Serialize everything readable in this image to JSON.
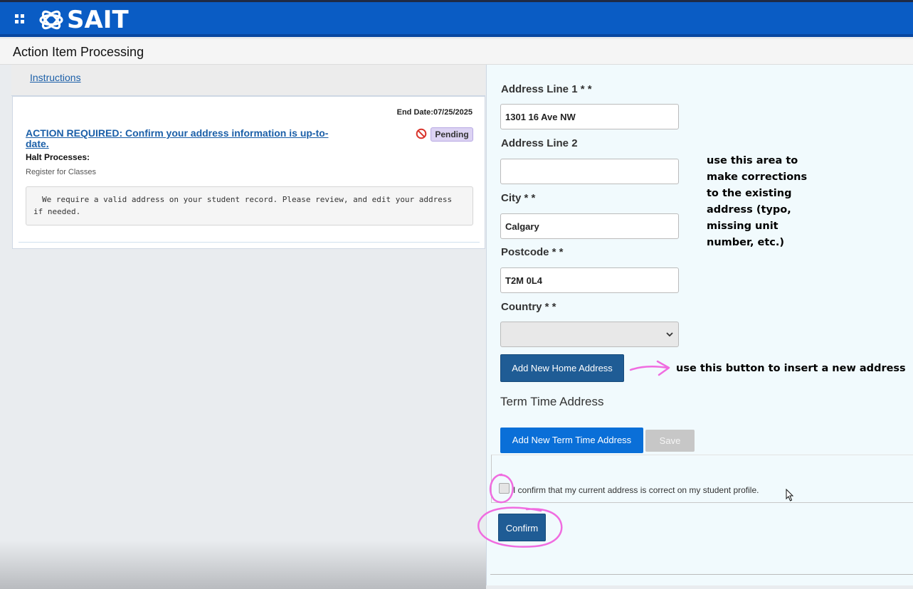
{
  "header": {
    "app_menu_icon": "grid-icon",
    "logo_text": "SAIT",
    "page_title": "Action Item Processing"
  },
  "left": {
    "instructions_link": "Instructions",
    "end_date": "End Date:07/25/2025",
    "action_title": "ACTION REQUIRED: Confirm your address information is up-to-date.",
    "status_icon": "no-entry-icon",
    "status_badge": "Pending",
    "halt_label": "Halt Processes:",
    "halt_value": "Register for Classes",
    "message": "We require a valid address on your student record. Please review, and edit your address if needed."
  },
  "form": {
    "address1_label": "Address Line 1 * *",
    "address1_value": "1301 16 Ave NW",
    "address2_label": "Address Line 2",
    "address2_value": "",
    "city_label": "City * *",
    "city_value": "Calgary",
    "postcode_label": "Postcode * *",
    "postcode_value": "T2M 0L4",
    "country_label": "Country * *",
    "country_value": "",
    "add_home_button": "Add New Home Address",
    "term_heading": "Term Time Address",
    "add_term_button": "Add New Term Time Address",
    "save_button": "Save",
    "confirm_text": "I confirm that my current address is correct on my student profile.",
    "confirm_button": "Confirm"
  },
  "annotations": {
    "corrections_note": [
      "use this area to",
      "make corrections",
      "to the existing",
      "address (typo,",
      "missing unit",
      "number, etc.)"
    ],
    "new_address_note": "use this button to insert a new address",
    "ink_color": "#f06ce0"
  }
}
